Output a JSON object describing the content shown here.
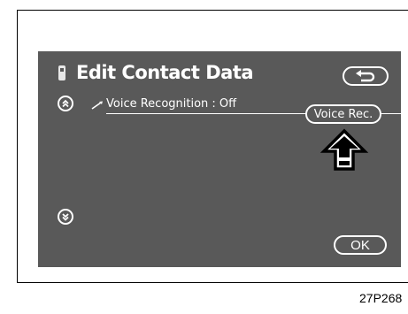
{
  "header": {
    "title": "Edit Contact Data",
    "phone_icon": "mobile-phone-icon",
    "back_icon": "return-arrow-icon"
  },
  "list": {
    "scroll_up_icon": "double-chevron-up-icon",
    "scroll_down_icon": "double-chevron-down-icon",
    "rows": [
      {
        "icon": "edit-pencil-icon",
        "label": "Voice Recognition : Off"
      }
    ]
  },
  "buttons": {
    "voice_rec": "Voice Rec.",
    "ok": "OK"
  },
  "callout": {
    "icon": "pointer-arrow-up-icon"
  },
  "figure_code": "27P268",
  "colors": {
    "screen": "#595959",
    "foreground": "#ffffff"
  }
}
